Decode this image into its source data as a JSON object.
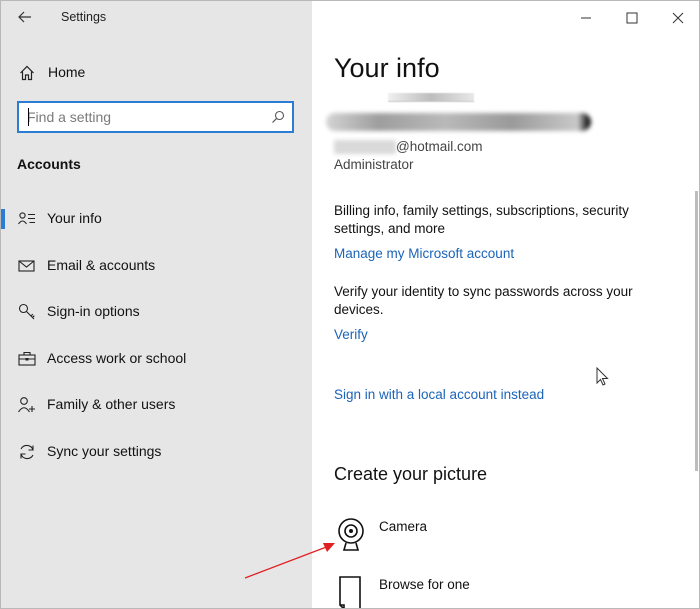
{
  "window": {
    "app_title": "Settings",
    "controls": [
      "minimize-icon",
      "maximize-icon",
      "close-icon"
    ]
  },
  "sidebar": {
    "home_label": "Home",
    "search": {
      "placeholder": "Find a setting",
      "value": ""
    },
    "section_heading": "Accounts",
    "items": [
      {
        "label": "Your info",
        "icon": "person-list-icon",
        "selected": true
      },
      {
        "label": "Email & accounts",
        "icon": "envelope-icon",
        "selected": false
      },
      {
        "label": "Sign-in options",
        "icon": "key-icon",
        "selected": false
      },
      {
        "label": "Access work or school",
        "icon": "briefcase-icon",
        "selected": false
      },
      {
        "label": "Family & other users",
        "icon": "person-add-icon",
        "selected": false
      },
      {
        "label": "Sync your settings",
        "icon": "sync-icon",
        "selected": false
      }
    ]
  },
  "main": {
    "title": "Your info",
    "email_domain": "@hotmail.com",
    "role": "Administrator",
    "billing_text": "Billing info, family settings, subscriptions, security settings, and more",
    "manage_link": "Manage my Microsoft account",
    "verify_text": "Verify your identity to sync passwords across your devices.",
    "verify_link": "Verify",
    "local_account_link": "Sign in with a local account instead",
    "picture_section_title": "Create your picture",
    "picture_options": [
      {
        "label": "Camera",
        "icon": "camera-icon"
      },
      {
        "label": "Browse for one",
        "icon": "file-browse-icon"
      }
    ]
  },
  "colors": {
    "accent": "#2b7cd3",
    "link": "#1b64b8",
    "sidebar_bg": "#e6e6e6",
    "annotation_arrow": "#e02020"
  }
}
